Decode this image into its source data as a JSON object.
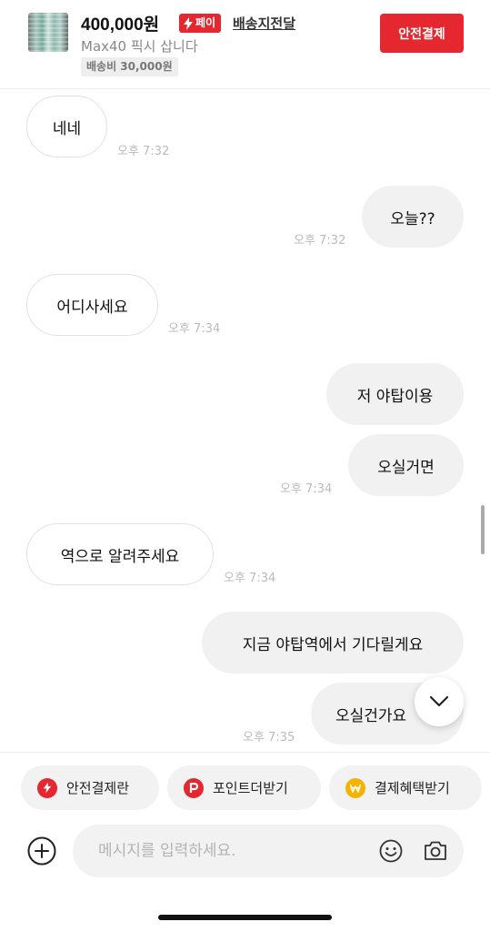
{
  "header": {
    "price": "400,000원",
    "pay_badge": "페이",
    "delivery_link": "배송지전달",
    "product_title": "Max40 픽시 삽니다",
    "shipping_tag": "배송비 30,000원",
    "safe_pay_button": "안전결제"
  },
  "messages": [
    {
      "direction": "in",
      "text": "네네",
      "time": "오후 7:32"
    },
    {
      "direction": "out",
      "text": "오늘??",
      "time": "오후 7:32"
    },
    {
      "direction": "in",
      "text": "어디사세요",
      "time": "오후 7:34"
    },
    {
      "direction": "out",
      "text": "저 야탑이용",
      "time": ""
    },
    {
      "direction": "out",
      "text": "오실거면",
      "time": "오후 7:34"
    },
    {
      "direction": "in",
      "text": "역으로 알려주세요",
      "time": "오후 7:34"
    },
    {
      "direction": "out",
      "text": "지금 야탑역에서 기다릴게요",
      "time": ""
    },
    {
      "direction": "out",
      "text": "오실건가요",
      "time": "오후 7:35"
    }
  ],
  "chips": [
    {
      "label": "안전결제란",
      "icon": "lightning-icon",
      "color": "#e5272f"
    },
    {
      "label": "포인트더받기",
      "icon": "point-p-icon",
      "color": "#e5272f"
    },
    {
      "label": "결제혜택받기",
      "icon": "won-coin-icon",
      "color": "#f5b301"
    }
  ],
  "input": {
    "placeholder": "메시지를 입력하세요.",
    "value": ""
  },
  "colors": {
    "accent": "#e5272f",
    "bubble_out": "#f1f1f1",
    "bubble_in_border": "#e2e2e2",
    "time_text": "#bbbbbb"
  }
}
